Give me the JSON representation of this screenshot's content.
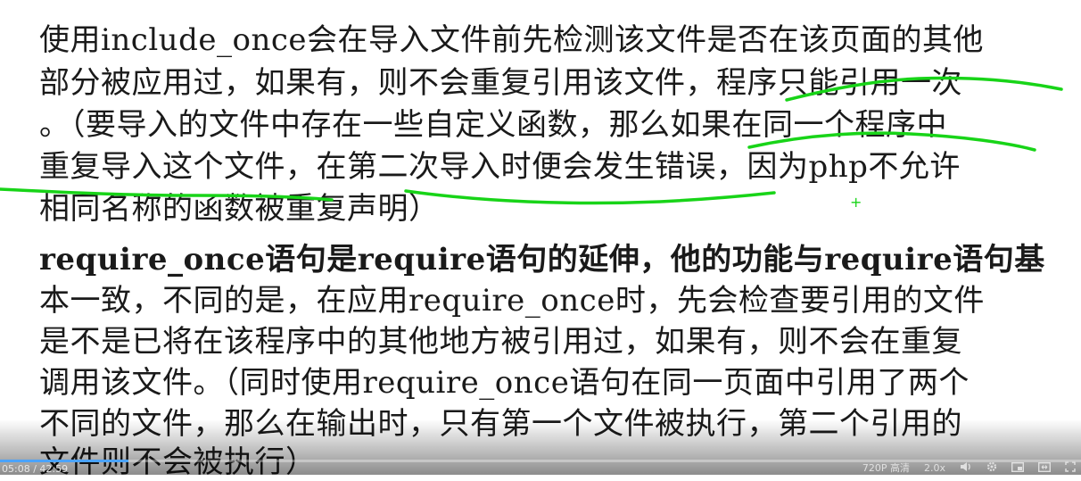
{
  "document": {
    "lines": [
      "使用include_once会在导入文件前先检测该文件是否在该页面的其他",
      "部分被应用过，如果有，则不会重复引用该文件，程序只能引用一次",
      "。（要导入的文件中存在一些自定义函数，那么如果在同一个程序中",
      "重复导入这个文件，在第二次导入时便会发生错误，因为php不允许",
      "相同名称的函数被重复声明）",
      "require_once语句是require语句的延伸，他的功能与require语句基",
      "本一致，不同的是，在应用require_once时，先会检查要引用的文件",
      "是不是已将在该程序中的其他地方被引用过，如果有，则不会在重复",
      "调用该文件。（同时使用require_once语句在同一页面中引用了两个",
      "不同的文件，那么在输出时，只有第一个文件被执行，第二个引用的",
      "文件则不会被执行）"
    ]
  },
  "annotation": {
    "ink_color": "#18d418",
    "marker": "+"
  },
  "player": {
    "current_time": "05:08",
    "separator": " / ",
    "total_time": "42:59",
    "progress": 0.119,
    "quality": "720P 高清",
    "speed": "2.0x",
    "accent_color": "#4aa3ff",
    "icons": [
      "volume-icon",
      "settings-icon",
      "pip-icon",
      "widescreen-icon",
      "fullscreen-icon"
    ]
  }
}
